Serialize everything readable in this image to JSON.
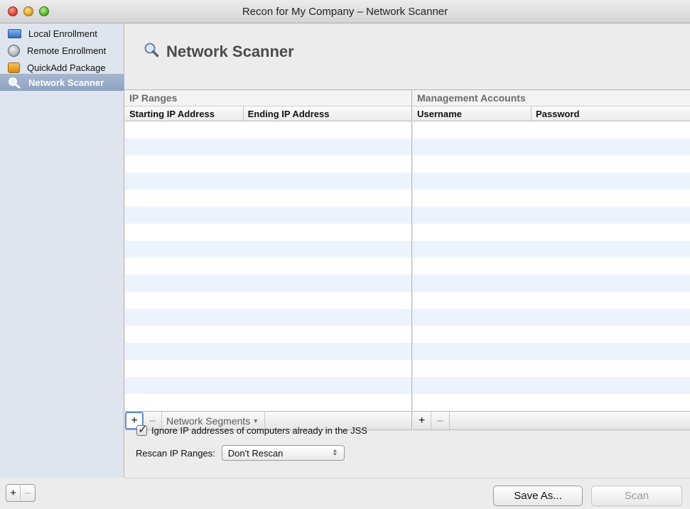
{
  "window": {
    "title": "Recon for My Company – Network Scanner"
  },
  "sidebar": {
    "items": [
      {
        "label": "Local Enrollment",
        "icon": "monitor-icon"
      },
      {
        "label": "Remote Enrollment",
        "icon": "globe-icon"
      },
      {
        "label": "QuickAdd Package",
        "icon": "package-icon"
      },
      {
        "label": "Network Scanner",
        "icon": "magnifier-icon",
        "selected": true
      }
    ],
    "footer": {
      "add": "+",
      "remove": "–"
    }
  },
  "main": {
    "title": "Network Scanner",
    "ip_ranges": {
      "title": "IP Ranges",
      "columns": [
        "Starting IP Address",
        "Ending IP Address"
      ],
      "rows": [],
      "footer": {
        "add": "+",
        "remove": "–",
        "menu": "Network Segments"
      }
    },
    "accounts": {
      "title": "Management Accounts",
      "columns": [
        "Username",
        "Password"
      ],
      "rows": [],
      "footer": {
        "add": "+",
        "remove": "–"
      }
    },
    "ignore_checkbox": {
      "label": "Ignore IP addresses of computers already in the JSS",
      "checked": true
    },
    "rescan": {
      "label": "Rescan IP Ranges:",
      "value": "Don't Rescan"
    }
  },
  "buttons": {
    "save_as": "Save As...",
    "scan": "Scan"
  },
  "colors": {
    "selection": "#8ea3c2",
    "row_stripe": "#edf3fe",
    "sidebar_bg": "#dfe5ee"
  }
}
